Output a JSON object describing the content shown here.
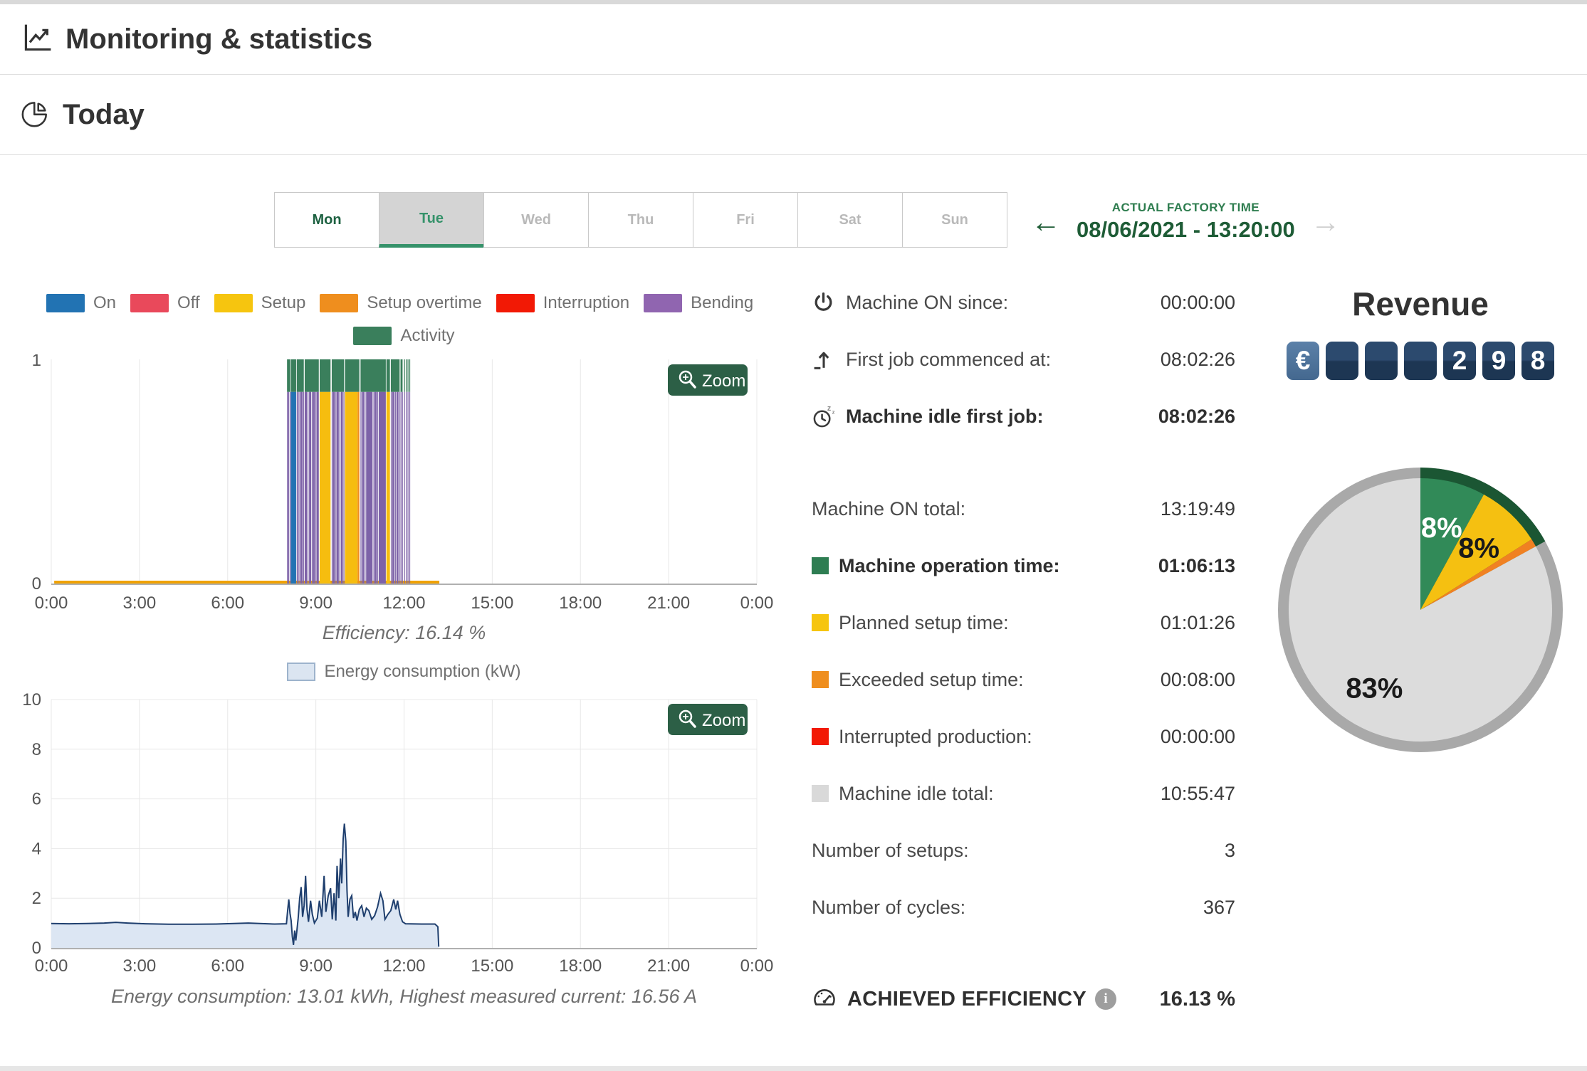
{
  "page": {
    "title": "Monitoring & statistics",
    "section": "Today"
  },
  "tabs": {
    "days": [
      {
        "label": "Mon",
        "state": "past"
      },
      {
        "label": "Tue",
        "state": "selected"
      },
      {
        "label": "Wed",
        "state": "future"
      },
      {
        "label": "Thu",
        "state": "future"
      },
      {
        "label": "Fri",
        "state": "future"
      },
      {
        "label": "Sat",
        "state": "future"
      },
      {
        "label": "Sun",
        "state": "future"
      }
    ]
  },
  "factory_time": {
    "label": "ACTUAL FACTORY TIME",
    "value": "08/06/2021 - 13:20:00",
    "prev_arrow": "←",
    "next_arrow": "→"
  },
  "legend": {
    "row1": [
      {
        "label": "On",
        "color": "#2273b3"
      },
      {
        "label": "Off",
        "color": "#e9495b"
      },
      {
        "label": "Setup",
        "color": "#f6c50f"
      },
      {
        "label": "Setup overtime",
        "color": "#ef8e1e"
      },
      {
        "label": "Interruption",
        "color": "#f21905"
      },
      {
        "label": "Bending",
        "color": "#9065b0"
      }
    ],
    "row2": [
      {
        "label": "Activity",
        "color": "#3a7f5c"
      }
    ]
  },
  "zoom_button": {
    "label": "Zoom"
  },
  "chart_data": [
    {
      "type": "bar",
      "name": "machine-activity-timeline",
      "x_ticks": [
        "0:00",
        "3:00",
        "6:00",
        "9:00",
        "12:00",
        "15:00",
        "18:00",
        "21:00",
        "0:00"
      ],
      "x_hours": [
        0,
        3,
        6,
        9,
        12,
        15,
        18,
        21,
        24
      ],
      "ylim": [
        0,
        1
      ],
      "y_ticks": [
        "0",
        "1"
      ],
      "caption": "Efficiency: 16.14 %",
      "bar_top": 0.855,
      "colors": {
        "blue": "#2273b3",
        "purple": "#7d62a8",
        "yellow": "#f6bd0f",
        "orange": "#ef8e1e",
        "green": "#3a7f5c"
      },
      "baseline": {
        "color": "#f0a202",
        "from_h": 0.1,
        "to_h": 13.2
      },
      "segments": [
        [
          8.02,
          8.05,
          "purple"
        ],
        [
          8.06,
          8.09,
          "purple"
        ],
        [
          8.11,
          8.13,
          "purple"
        ],
        [
          8.15,
          8.33,
          "blue"
        ],
        [
          8.35,
          8.37,
          "purple"
        ],
        [
          8.39,
          8.42,
          "purple"
        ],
        [
          8.44,
          8.46,
          "purple"
        ],
        [
          8.48,
          8.55,
          "purple"
        ],
        [
          8.57,
          8.59,
          "purple"
        ],
        [
          8.62,
          8.7,
          "purple"
        ],
        [
          8.72,
          8.74,
          "purple"
        ],
        [
          8.77,
          8.84,
          "purple"
        ],
        [
          8.86,
          8.88,
          "purple"
        ],
        [
          8.9,
          8.97,
          "purple"
        ],
        [
          8.99,
          9.01,
          "purple"
        ],
        [
          9.03,
          9.1,
          "purple"
        ],
        [
          9.13,
          9.5,
          "yellow"
        ],
        [
          9.54,
          9.56,
          "purple"
        ],
        [
          9.58,
          9.65,
          "purple"
        ],
        [
          9.67,
          9.69,
          "purple"
        ],
        [
          9.71,
          9.78,
          "purple"
        ],
        [
          9.8,
          9.82,
          "purple"
        ],
        [
          9.85,
          9.92,
          "purple"
        ],
        [
          9.94,
          9.96,
          "purple"
        ],
        [
          9.99,
          10.42,
          "yellow"
        ],
        [
          10.42,
          10.48,
          "orange"
        ],
        [
          10.52,
          10.54,
          "purple"
        ],
        [
          10.57,
          10.64,
          "purple"
        ],
        [
          10.66,
          10.68,
          "purple"
        ],
        [
          10.71,
          10.93,
          "purple"
        ],
        [
          10.96,
          10.98,
          "purple"
        ],
        [
          11.0,
          11.07,
          "purple"
        ],
        [
          11.09,
          11.11,
          "purple"
        ],
        [
          11.14,
          11.38,
          "purple"
        ],
        [
          11.4,
          11.52,
          "yellow"
        ],
        [
          11.55,
          11.57,
          "purple"
        ],
        [
          11.6,
          11.67,
          "purple"
        ],
        [
          11.69,
          11.71,
          "purple"
        ],
        [
          11.74,
          11.81,
          "purple"
        ],
        [
          11.83,
          11.85,
          "purple"
        ],
        [
          11.88,
          11.9,
          "purple"
        ],
        [
          11.93,
          11.95,
          "purple"
        ],
        [
          12.0,
          12.02,
          "purple"
        ],
        [
          12.06,
          12.08,
          "purple"
        ],
        [
          12.12,
          12.14,
          "purple"
        ],
        [
          12.18,
          12.2,
          "purple"
        ]
      ],
      "activity_tops": [
        [
          8.02,
          8.13
        ],
        [
          8.15,
          8.33
        ],
        [
          8.35,
          8.59
        ],
        [
          8.62,
          9.1
        ],
        [
          9.13,
          9.5
        ],
        [
          9.54,
          9.96
        ],
        [
          9.99,
          10.48
        ],
        [
          10.52,
          11.38
        ],
        [
          11.4,
          11.52
        ],
        [
          11.55,
          11.85
        ],
        [
          11.88,
          11.95
        ],
        [
          12.0,
          12.02
        ],
        [
          12.06,
          12.08
        ],
        [
          12.12,
          12.14
        ],
        [
          12.18,
          12.2
        ]
      ]
    },
    {
      "type": "area",
      "name": "energy-consumption",
      "legend": "Energy consumption (kW)",
      "x_ticks": [
        "0:00",
        "3:00",
        "6:00",
        "9:00",
        "12:00",
        "15:00",
        "18:00",
        "21:00",
        "0:00"
      ],
      "x_hours": [
        0,
        3,
        6,
        9,
        12,
        15,
        18,
        21,
        24
      ],
      "ylim": [
        0,
        10
      ],
      "y_ticks": [
        0,
        2,
        4,
        6,
        8,
        10
      ],
      "caption": "Energy consumption: 13.01 kWh, Highest measured current: 16.56 A",
      "line_color": "#1f3f6e",
      "fill_color": "#dce6f3",
      "points": [
        [
          0,
          0.98
        ],
        [
          0.6,
          0.97
        ],
        [
          1.2,
          0.98
        ],
        [
          1.8,
          1.0
        ],
        [
          2.2,
          1.03
        ],
        [
          2.6,
          1.0
        ],
        [
          3.2,
          0.97
        ],
        [
          4,
          0.95
        ],
        [
          4.8,
          0.95
        ],
        [
          5.6,
          0.96
        ],
        [
          6.2,
          0.98
        ],
        [
          6.7,
          1.0
        ],
        [
          7.1,
          0.98
        ],
        [
          7.6,
          0.96
        ],
        [
          8.0,
          0.97
        ],
        [
          8.04,
          1.5
        ],
        [
          8.08,
          1.95
        ],
        [
          8.12,
          1.4
        ],
        [
          8.16,
          1.1
        ],
        [
          8.2,
          0.45
        ],
        [
          8.24,
          0.12
        ],
        [
          8.28,
          0.7
        ],
        [
          8.32,
          0.3
        ],
        [
          8.36,
          0.75
        ],
        [
          8.4,
          1.2
        ],
        [
          8.45,
          2.0
        ],
        [
          8.5,
          2.45
        ],
        [
          8.55,
          1.25
        ],
        [
          8.6,
          1.7
        ],
        [
          8.65,
          2.9
        ],
        [
          8.7,
          1.55
        ],
        [
          8.75,
          1.05
        ],
        [
          8.82,
          1.9
        ],
        [
          8.88,
          1.35
        ],
        [
          8.95,
          1.0
        ],
        [
          9.05,
          1.2
        ],
        [
          9.12,
          1.9
        ],
        [
          9.2,
          1.25
        ],
        [
          9.28,
          2.9
        ],
        [
          9.34,
          1.45
        ],
        [
          9.42,
          2.1
        ],
        [
          9.5,
          2.4
        ],
        [
          9.56,
          1.15
        ],
        [
          9.62,
          2.2
        ],
        [
          9.68,
          1.1
        ],
        [
          9.72,
          3.3
        ],
        [
          9.78,
          2.0
        ],
        [
          9.84,
          3.6
        ],
        [
          9.88,
          2.6
        ],
        [
          9.93,
          4.4
        ],
        [
          9.97,
          5.0
        ],
        [
          10.02,
          4.3
        ],
        [
          10.06,
          2.3
        ],
        [
          10.1,
          1.25
        ],
        [
          10.16,
          1.95
        ],
        [
          10.22,
          2.1
        ],
        [
          10.28,
          1.2
        ],
        [
          10.34,
          1.45
        ],
        [
          10.4,
          1.1
        ],
        [
          10.48,
          1.55
        ],
        [
          10.56,
          1.7
        ],
        [
          10.64,
          1.25
        ],
        [
          10.72,
          1.6
        ],
        [
          10.8,
          1.5
        ],
        [
          10.9,
          1.15
        ],
        [
          11.0,
          1.3
        ],
        [
          11.1,
          1.65
        ],
        [
          11.2,
          2.2
        ],
        [
          11.28,
          1.9
        ],
        [
          11.35,
          1.15
        ],
        [
          11.45,
          1.35
        ],
        [
          11.55,
          1.5
        ],
        [
          11.65,
          1.95
        ],
        [
          11.72,
          1.55
        ],
        [
          11.78,
          1.9
        ],
        [
          11.86,
          1.35
        ],
        [
          11.95,
          1.05
        ],
        [
          12.05,
          0.97
        ],
        [
          12.6,
          0.96
        ],
        [
          13.05,
          0.96
        ],
        [
          13.15,
          0.85
        ],
        [
          13.18,
          0.05
        ]
      ]
    },
    {
      "type": "pie",
      "name": "time-distribution",
      "slices": [
        {
          "pct": 8,
          "color": "#318a58",
          "label": "8%",
          "label_color": "#ffffff"
        },
        {
          "pct": 8,
          "color": "#f5c011",
          "label": "8%",
          "label_color": "#1a1a1a"
        },
        {
          "pct": 1,
          "color": "#f08122",
          "label": "",
          "label_color": ""
        },
        {
          "pct": 83,
          "color": "#dcdcdc",
          "label": "83%",
          "label_color": "#1a1a1a"
        }
      ],
      "ring": {
        "highlight_color": "#1b5633",
        "base_color": "#a9a9a9",
        "highlight_pct": 17
      }
    }
  ],
  "stats": {
    "rows": [
      {
        "icon": "power",
        "label": "Machine ON since:",
        "value": "00:00:00"
      },
      {
        "icon": "firstjob",
        "label": "First job commenced at:",
        "value": "08:02:26"
      },
      {
        "icon": "idleclock",
        "label": "Machine idle first job:",
        "value": "08:02:26",
        "bold": true
      },
      {
        "label": "Machine ON total:",
        "value": "13:19:49"
      },
      {
        "chip": "#2e7d52",
        "label": "Machine operation time:",
        "value": "01:06:13",
        "bold": true
      },
      {
        "chip": "#f6c50f",
        "label": "Planned setup time:",
        "value": "01:01:26"
      },
      {
        "chip": "#ef8e1e",
        "label": "Exceeded setup time:",
        "value": "00:08:00"
      },
      {
        "chip": "#f21905",
        "label": "Interrupted production:",
        "value": "00:00:00"
      },
      {
        "chip": "#d9d9d9",
        "label": "Machine idle total:",
        "value": "10:55:47"
      },
      {
        "label": "Number of setups:",
        "value": "3"
      },
      {
        "label": "Number of cycles:",
        "value": "367"
      }
    ],
    "efficiency": {
      "label": "ACHIEVED EFFICIENCY",
      "value": "16.13 %"
    }
  },
  "revenue": {
    "title": "Revenue",
    "currency": "€",
    "digits": [
      "",
      "",
      "",
      "2",
      "9",
      "8"
    ]
  }
}
